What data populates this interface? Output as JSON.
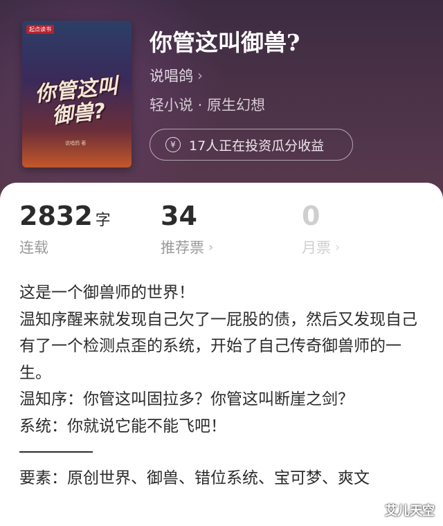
{
  "book": {
    "publisher_tag": "起点读书",
    "cover_title": "你管这叫御兽?",
    "cover_author": "说唱鸽 著",
    "title": "你管这叫御兽?",
    "author": "说唱鸽",
    "genre": "轻小说 · 原生幻想",
    "invest_text": "17人正在投资瓜分收益"
  },
  "stats": [
    {
      "value": "2832",
      "unit": "字",
      "label": "连载"
    },
    {
      "value": "34",
      "label": "推荐票"
    },
    {
      "value": "0",
      "label": "月票"
    }
  ],
  "description": {
    "lines": [
      "这是一个御兽师的世界！",
      "温知序醒来就发现自己欠了一屁股的债，然后又发现自己有了一个检测点歪的系统，开始了自己传奇御兽师的一生。",
      "温知序：你管这叫固拉多？你管这叫断崖之剑？",
      "系统：你就说它能不能飞吧！"
    ],
    "elements": "要素：原创世界、御兽、错位系统、宝可梦、爽文"
  },
  "watermark": "艾儿天空",
  "icons": {
    "chevron": "chevron-right-icon",
    "yen": "yen-coin-icon"
  },
  "colors": {
    "hero_bg": "#4b3247",
    "text_primary": "#2b2b2b",
    "text_muted": "#9a9a9a"
  }
}
